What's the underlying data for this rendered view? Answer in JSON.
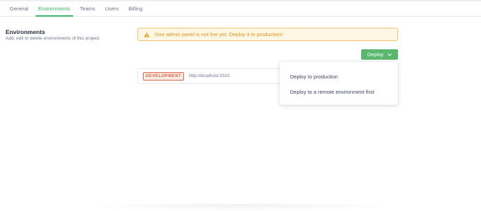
{
  "tabs": [
    {
      "label": "General",
      "active": false
    },
    {
      "label": "Environments",
      "active": true
    },
    {
      "label": "Teams",
      "active": false
    },
    {
      "label": "Users",
      "active": false
    },
    {
      "label": "Billing",
      "active": false
    }
  ],
  "section": {
    "title": "Environments",
    "description": "Add, edit or delete environments of this project."
  },
  "warning": {
    "icon": "warning-triangle-icon",
    "text": "Your admin panel is not live yet. Deploy it to production!"
  },
  "deploy_button": {
    "label": "Deploy",
    "icon": "chevron-down-icon"
  },
  "environment": {
    "badge": "DEVELOPMENT",
    "url": "http://localhost:3310"
  },
  "dropdown": {
    "items": [
      {
        "label": "Deploy to production"
      },
      {
        "label": "Deploy to a remote environment first"
      }
    ]
  },
  "colors": {
    "accent": "#3db26b",
    "button": "#59b86d",
    "warning_bg": "#fff6e3",
    "warning_border": "#f3c66b",
    "warning_text": "#d99621",
    "badge": "#e0654b"
  }
}
